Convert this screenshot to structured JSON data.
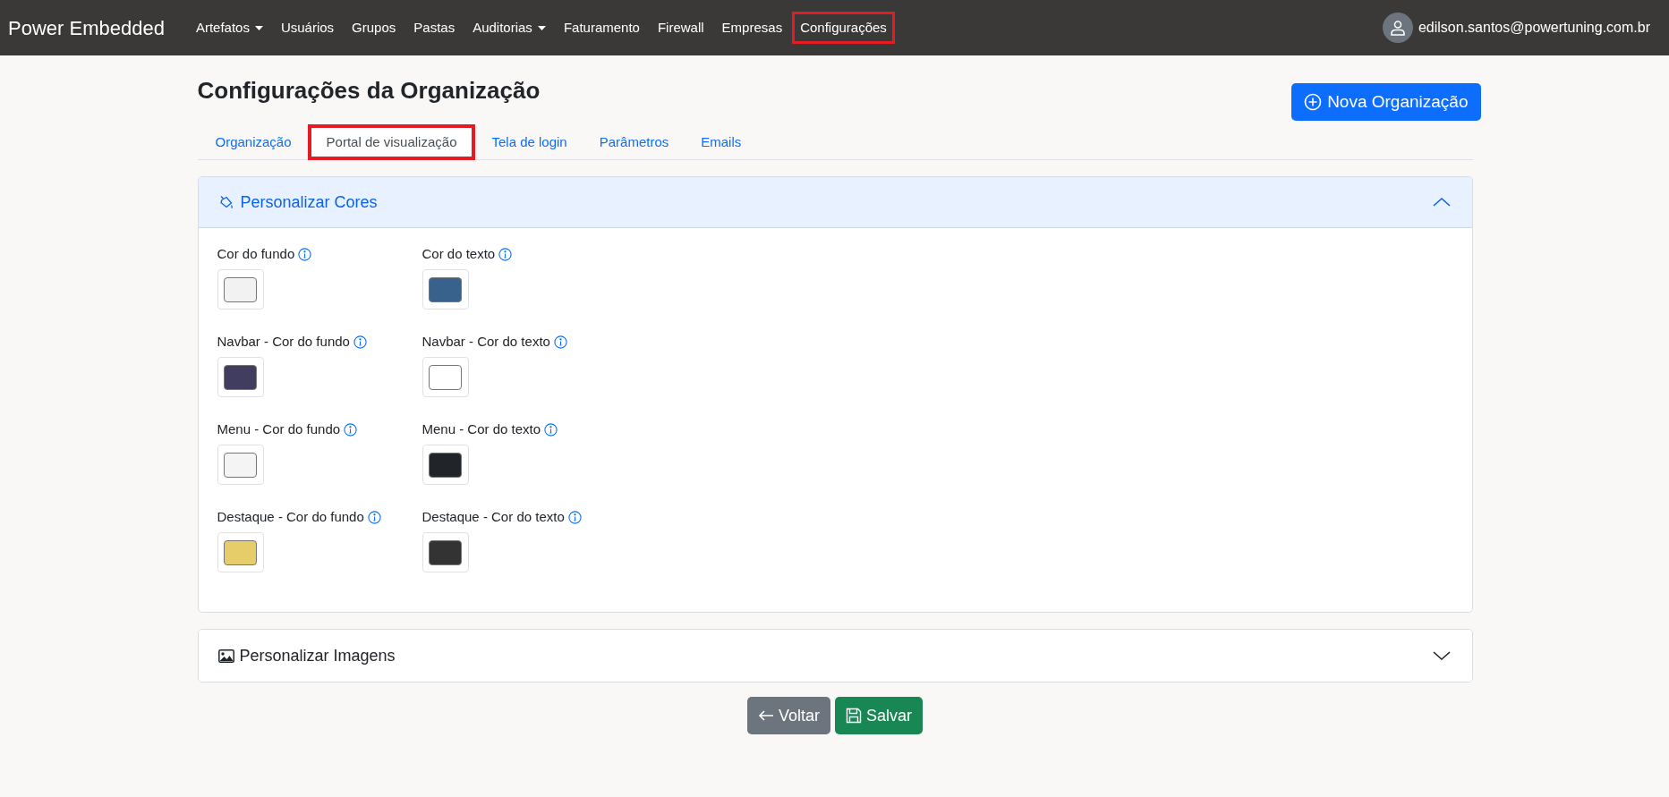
{
  "navbar": {
    "brand": "Power Embedded",
    "items": [
      {
        "label": "Artefatos",
        "dropdown": true,
        "highlighted": false
      },
      {
        "label": "Usuários",
        "dropdown": false,
        "highlighted": false
      },
      {
        "label": "Grupos",
        "dropdown": false,
        "highlighted": false
      },
      {
        "label": "Pastas",
        "dropdown": false,
        "highlighted": false
      },
      {
        "label": "Auditorias",
        "dropdown": true,
        "highlighted": false
      },
      {
        "label": "Faturamento",
        "dropdown": false,
        "highlighted": false
      },
      {
        "label": "Firewall",
        "dropdown": false,
        "highlighted": false
      },
      {
        "label": "Empresas",
        "dropdown": false,
        "highlighted": false
      },
      {
        "label": "Configurações",
        "dropdown": false,
        "highlighted": true
      }
    ],
    "user": "edilson.santos@powertuning.com.br"
  },
  "page": {
    "title": "Configurações da Organização",
    "new_button": "Nova Organização"
  },
  "tabs": [
    {
      "label": "Organização",
      "selected": false,
      "highlighted": false
    },
    {
      "label": "Portal de visualização",
      "selected": true,
      "highlighted": true
    },
    {
      "label": "Tela de login",
      "selected": false,
      "highlighted": false
    },
    {
      "label": "Parâmetros",
      "selected": false,
      "highlighted": false
    },
    {
      "label": "Emails",
      "selected": false,
      "highlighted": false
    }
  ],
  "sections": [
    {
      "title": "Personalizar Cores",
      "kind": "colors",
      "expanded": true,
      "fields": [
        {
          "label": "Cor do fundo",
          "color": "#f2f2f2"
        },
        {
          "label": "Cor do texto",
          "color": "#38618c"
        },
        {
          "label": "Navbar - Cor do fundo",
          "color": "#403d5e"
        },
        {
          "label": "Navbar - Cor do texto",
          "color": "#ffffff"
        },
        {
          "label": "Menu - Cor do fundo",
          "color": "#f4f4f4"
        },
        {
          "label": "Menu - Cor do texto",
          "color": "#212529"
        },
        {
          "label": "Destaque - Cor do fundo",
          "color": "#e6cd6a"
        },
        {
          "label": "Destaque - Cor do texto",
          "color": "#333333"
        }
      ]
    },
    {
      "title": "Personalizar Imagens",
      "kind": "images",
      "expanded": false
    }
  ],
  "buttons": [
    {
      "label": "Voltar",
      "kind": "back"
    },
    {
      "label": "Salvar",
      "kind": "save"
    }
  ]
}
